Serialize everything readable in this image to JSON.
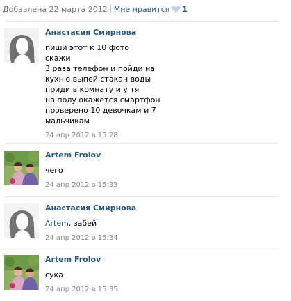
{
  "header": {
    "added_text": "Добавлена 22 марта 2012",
    "like_link": "Мне нравится",
    "like_count": "1",
    "heart_color": "#c4d2e1"
  },
  "comments": [
    {
      "author": "Анастасия Смирнова",
      "avatar": "female-silhouette-avatar",
      "text": "пиши этот к 10 фото\nскажи\n3 раза телефон и пойди на\nкухню выпей стакан воды\nприди в комнату и у тя\nна полу окажется смартфон\nпроверено 10 девочкам и 7\nмальчикам",
      "time": "24 апр 2012 в 15:28"
    },
    {
      "author": "Artem Frolov",
      "avatar": "couple-photo-avatar",
      "text": "чего",
      "time": "24 апр 2012 в 15:33"
    },
    {
      "author": "Анастасия Смирнова",
      "avatar": "female-silhouette-avatar",
      "reply_to": "Artem",
      "text": ", забей",
      "time": "24 апр 2012 в 15:34"
    },
    {
      "author": "Artem Frolov",
      "avatar": "couple-photo-avatar",
      "text": "сука",
      "time": "24 апр 2012 в 15:35"
    }
  ],
  "colors": {
    "link": "#2b587a",
    "meta": "#8a8a8a",
    "divider": "#e7eaed"
  }
}
